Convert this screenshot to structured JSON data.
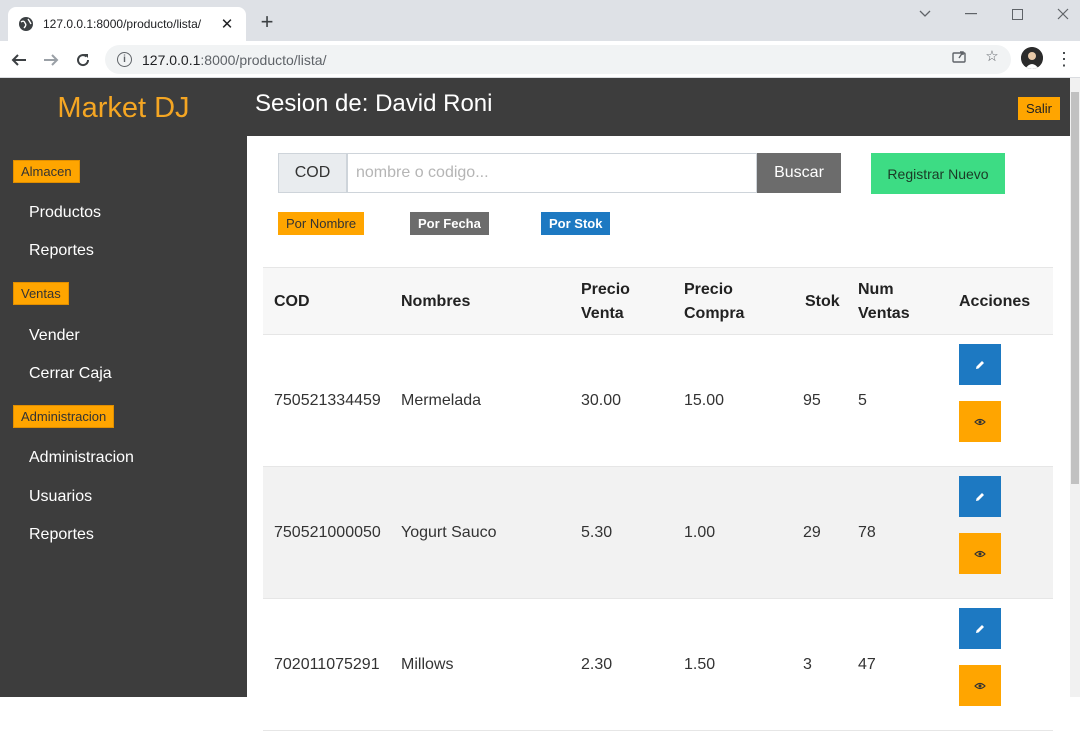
{
  "browser": {
    "tab_title": "127.0.0.1:8000/producto/lista/",
    "url_host": "127.0.0.1",
    "url_rest": ":8000/producto/lista/"
  },
  "sidebar": {
    "brand": "Market DJ",
    "sections": [
      {
        "label": "Almacen",
        "items": [
          "Productos",
          "Reportes"
        ]
      },
      {
        "label": "Ventas",
        "items": [
          "Vender",
          "Cerrar Caja"
        ]
      },
      {
        "label": "Administracion",
        "items": [
          "Administracion",
          "Usuarios",
          "Reportes"
        ]
      }
    ]
  },
  "header": {
    "session": "Sesion de: David Roni",
    "logout": "Salir"
  },
  "search": {
    "addon": "COD",
    "placeholder": "nombre o codigo...",
    "button": "Buscar",
    "register": "Registrar Nuevo"
  },
  "filters": {
    "by_name": "Por Nombre",
    "by_date": "Por Fecha",
    "by_stock": "Por Stok"
  },
  "table": {
    "headers": {
      "cod": "COD",
      "nombres": "Nombres",
      "precio_venta": "Precio Venta",
      "precio_compra": "Precio Compra",
      "stok": "Stok",
      "num_ventas": "Num Ventas",
      "acciones": "Acciones"
    },
    "rows": [
      {
        "cod": "750521334459",
        "nombre": "Mermelada",
        "precio_venta": "30.00",
        "precio_compra": "15.00",
        "stok": "95",
        "num_ventas": "5"
      },
      {
        "cod": "750521000050",
        "nombre": "Yogurt Sauco",
        "precio_venta": "5.30",
        "precio_compra": "1.00",
        "stok": "29",
        "num_ventas": "78"
      },
      {
        "cod": "702011075291",
        "nombre": "Millows",
        "precio_venta": "2.30",
        "precio_compra": "1.50",
        "stok": "3",
        "num_ventas": "47"
      }
    ]
  },
  "icons": {
    "edit": "pencil-icon",
    "view": "eye-icon"
  },
  "colors": {
    "sidebar_bg": "#3d3d3d",
    "brand": "#f5a623",
    "badge": "#ffa500",
    "primary": "#1d79c2",
    "success": "#3ddc84",
    "secondary": "#6c6c6c"
  }
}
